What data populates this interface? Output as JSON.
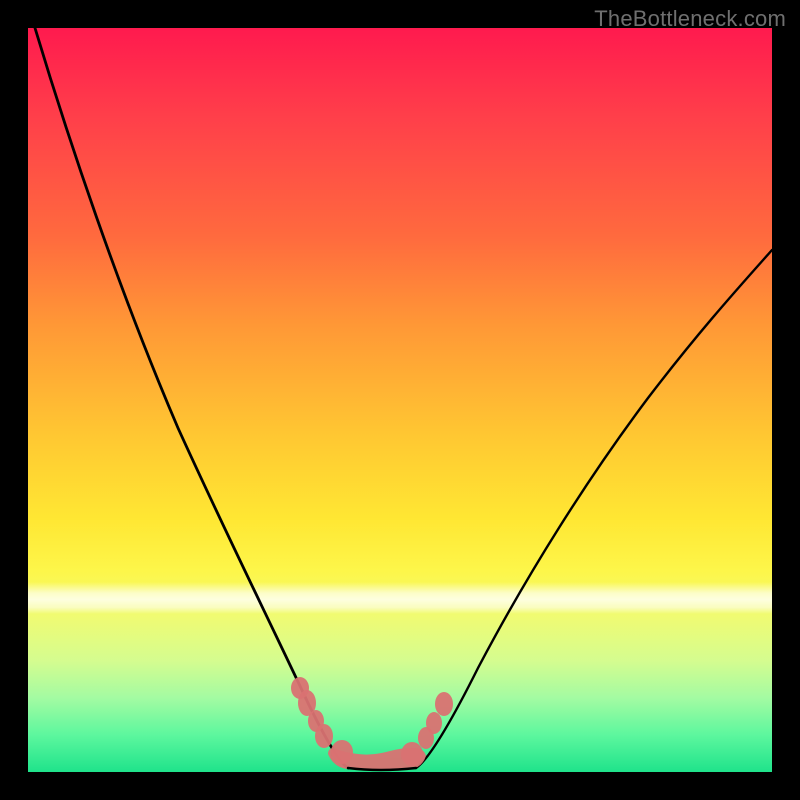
{
  "watermark": "TheBottleneck.com",
  "colors": {
    "gradient_top": "#ff1a4e",
    "gradient_bottom": "#1fe38b",
    "curve": "#000000",
    "blob": "#d97272",
    "frame": "#000000"
  },
  "chart_data": {
    "type": "line",
    "title": "",
    "xlabel": "",
    "ylabel": "",
    "xlim": [
      0,
      100
    ],
    "ylim": [
      0,
      100
    ],
    "grid": false,
    "legend": false,
    "series": [
      {
        "name": "left-curve",
        "x": [
          1,
          4,
          8,
          12,
          16,
          20,
          24,
          27,
          30,
          33,
          36,
          38,
          40,
          42
        ],
        "y": [
          100,
          90,
          78,
          66,
          55,
          44,
          34,
          26,
          19,
          13,
          8,
          4,
          2,
          0.5
        ]
      },
      {
        "name": "valley-floor",
        "x": [
          42,
          44,
          46,
          48,
          50,
          52
        ],
        "y": [
          0.5,
          0.2,
          0.2,
          0.2,
          0.3,
          0.8
        ]
      },
      {
        "name": "right-curve",
        "x": [
          52,
          55,
          58,
          62,
          66,
          70,
          75,
          80,
          85,
          90,
          95,
          100
        ],
        "y": [
          0.8,
          3,
          7,
          13,
          20,
          27,
          36,
          44,
          52,
          59,
          65,
          70
        ]
      }
    ],
    "annotations": [
      {
        "name": "marker-cluster-left",
        "x_range": [
          35,
          40
        ],
        "y_range": [
          3,
          11
        ]
      },
      {
        "name": "marker-cluster-right",
        "x_range": [
          51,
          56
        ],
        "y_range": [
          3,
          9
        ]
      },
      {
        "name": "valley-lobe",
        "x_range": [
          40,
          52
        ],
        "y_range": [
          0,
          2.5
        ]
      }
    ],
    "background_gradient_band": {
      "y_center": 24,
      "description": "bright-near-white-band"
    }
  }
}
